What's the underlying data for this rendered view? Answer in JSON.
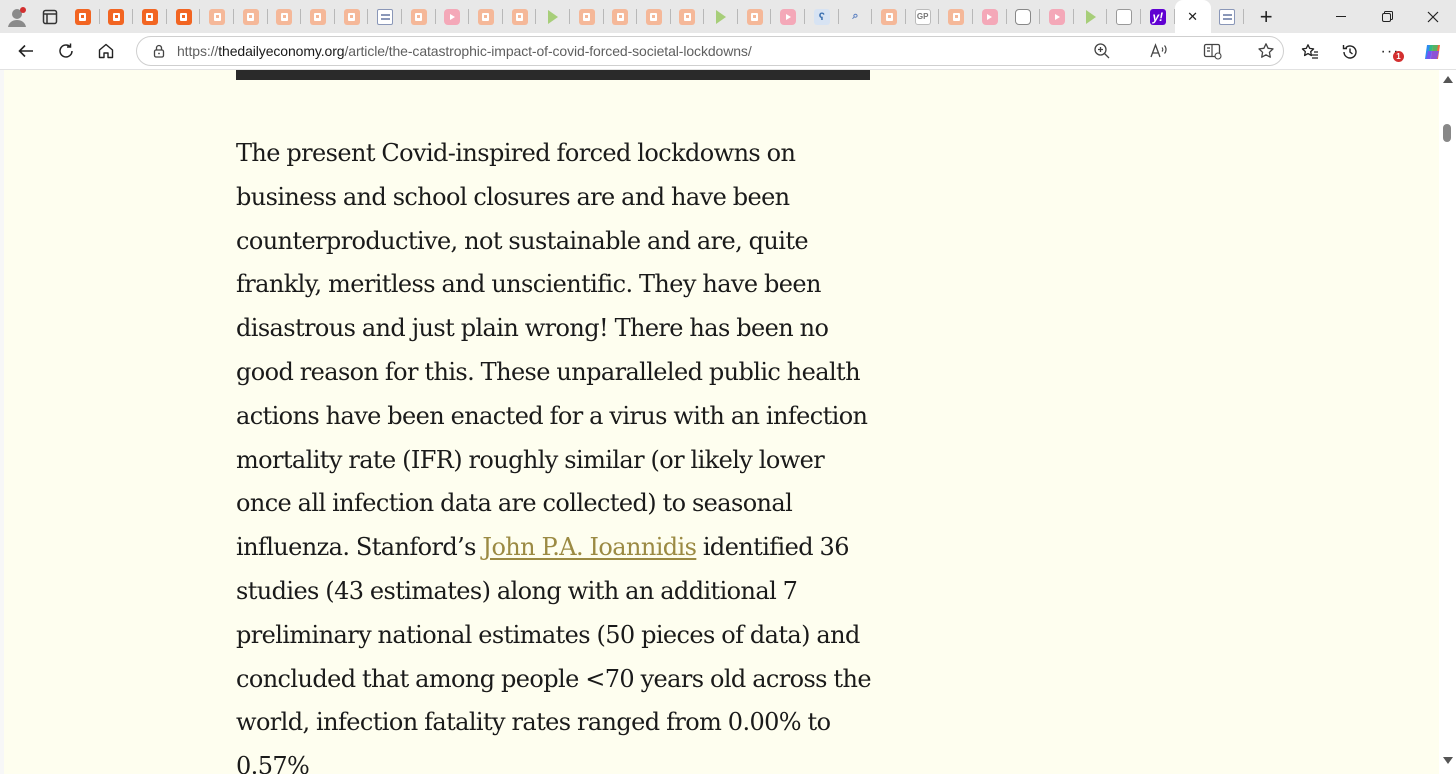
{
  "browser": {
    "tab_count_icons": 35,
    "tabs": [
      {
        "kind": "orange"
      },
      {
        "kind": "orange"
      },
      {
        "kind": "orange"
      },
      {
        "kind": "orange"
      },
      {
        "kind": "peach"
      },
      {
        "kind": "peach"
      },
      {
        "kind": "peach"
      },
      {
        "kind": "peach"
      },
      {
        "kind": "peach"
      },
      {
        "kind": "news"
      },
      {
        "kind": "peach"
      },
      {
        "kind": "pink"
      },
      {
        "kind": "peach"
      },
      {
        "kind": "peach"
      },
      {
        "kind": "play"
      },
      {
        "kind": "peach"
      },
      {
        "kind": "peach"
      },
      {
        "kind": "peach"
      },
      {
        "kind": "peach"
      },
      {
        "kind": "play"
      },
      {
        "kind": "peach"
      },
      {
        "kind": "pink"
      },
      {
        "kind": "blue",
        "glyph": "ʕ"
      },
      {
        "kind": "search",
        "glyph": "⌕"
      },
      {
        "kind": "peach"
      },
      {
        "kind": "gp",
        "glyph": "GP"
      },
      {
        "kind": "peach"
      },
      {
        "kind": "pink"
      },
      {
        "kind": "robot"
      },
      {
        "kind": "pink"
      },
      {
        "kind": "play"
      },
      {
        "kind": "grid"
      },
      {
        "kind": "yahoo",
        "glyph": "y!"
      }
    ],
    "active_tab_close": "✕",
    "new_tab": "+",
    "url_scheme": "https://",
    "url_host": "thedailyeconomy.org",
    "url_path": "/article/the-catastrophic-impact-of-covid-forced-societal-lockdowns/",
    "notification_count": "1"
  },
  "article": {
    "text_before_link": "The present Covid-inspired forced lockdowns on business and school closures are and have been counterproductive, not sustainable and are, quite frankly, meritless and unscientific. They have been disastrous and just plain wrong! There has been no good reason for this. These unparalleled public health actions have been enacted for a virus with an infection mortality rate (IFR) roughly similar (or likely lower once all infection data are collected) to seasonal influenza. Stanford’s ",
    "link_text": "John P.A. Ioannidis",
    "text_after_link": " identified 36 studies (43 estimates) along with an additional 7 preliminary national estimates (50 pieces of data) and concluded that among people <70 years old across the world, infection fatality rates ranged from 0.00% to 0.57%"
  }
}
